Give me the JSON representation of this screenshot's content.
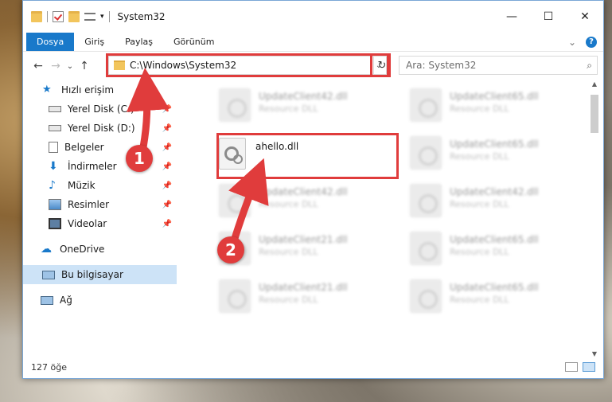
{
  "window": {
    "title": "System32"
  },
  "caption": {
    "minimize": "—",
    "maximize": "☐",
    "close": "✕"
  },
  "ribbon": {
    "tabs": [
      "Dosya",
      "Giriş",
      "Paylaş",
      "Görünüm"
    ],
    "collapse": "⌄",
    "help": "?"
  },
  "nav": {
    "back": "←",
    "forward": "→",
    "recent": "⌄",
    "up": "↑"
  },
  "address": {
    "path": "C:\\Windows\\System32",
    "dropdown": "⌄",
    "refresh": "↻"
  },
  "search": {
    "placeholder": "Ara: System32",
    "icon": "⌕"
  },
  "sidebar": {
    "quick_access": "Hızlı erişim",
    "items": [
      {
        "label": "Yerel Disk (C:)"
      },
      {
        "label": "Yerel Disk (D:)"
      },
      {
        "label": "Belgeler"
      },
      {
        "label": "İndirmeler"
      },
      {
        "label": "Müzik"
      },
      {
        "label": "Resimler"
      },
      {
        "label": "Videolar"
      }
    ],
    "onedrive": "OneDrive",
    "this_pc": "Bu bilgisayar",
    "network": "Ağ",
    "pin": "📌"
  },
  "files": {
    "left_col": [
      {
        "name": "UpdateClient42.dll",
        "type": "Resource DLL"
      },
      {
        "name": "UpdateClient42.dll",
        "type": "Resource DLL"
      },
      {
        "name": "UpdateClient21.dll",
        "type": "Resource DLL"
      },
      {
        "name": "UpdateClient21.dll",
        "type": "Resource DLL"
      }
    ],
    "right_col": [
      {
        "name": "UpdateClient65.dll",
        "type": "Resource DLL"
      },
      {
        "name": "UpdateClient65.dll",
        "type": "Resource DLL"
      },
      {
        "name": "UpdateClient42.dll",
        "type": "Resource DLL"
      },
      {
        "name": "UpdateClient65.dll",
        "type": "Resource DLL"
      },
      {
        "name": "UpdateClient65.dll",
        "type": "Resource DLL"
      }
    ],
    "target": {
      "name": "ahello.dll"
    }
  },
  "status": {
    "count": "127 öğe"
  },
  "badges": {
    "one": "1",
    "two": "2"
  },
  "colors": {
    "accent": "#1979ca",
    "highlight": "#e03c3c"
  }
}
